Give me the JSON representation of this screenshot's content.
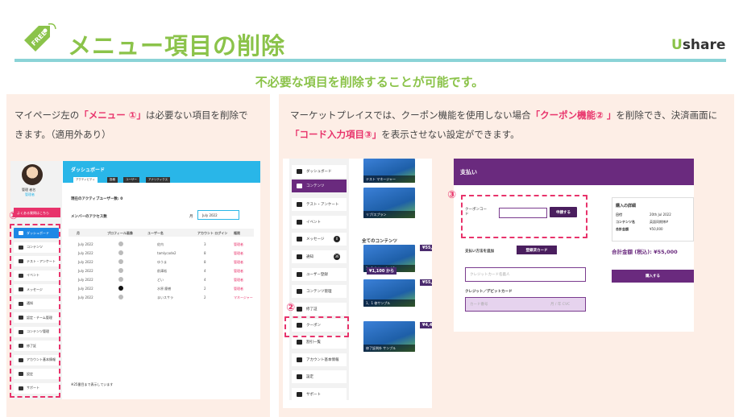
{
  "header": {
    "badge": "FREE",
    "title": "メニュー項目の削除",
    "logo_u": "U",
    "logo_rest": "share",
    "subtitle": "不必要な項目を削除することが可能です。"
  },
  "left": {
    "desc_1": "マイページ左の",
    "desc_hl": "「メニュー ①」",
    "desc_2": "は必要ない項目を削除できます。（適用外あり）",
    "callout_num": "①",
    "dashboard_title": "ダッシュボード",
    "tabs": [
      "アクティビティ",
      "投稿",
      "ユーザー",
      "アナリティクス"
    ],
    "active_users": "現在のアクティブユーザー数: 0",
    "access_title": "メンバーのアクセス数",
    "month_label": "月",
    "month_value": "July 2022",
    "columns": [
      "月",
      "プロフィール画像",
      "ユーザー名",
      "アカウント ログイン",
      "権限"
    ],
    "rows": [
      [
        "July 2022",
        "佐内",
        "3",
        "管理者"
      ],
      [
        "July 2022",
        "tamlycode2",
        "8",
        "管理者"
      ],
      [
        "July 2022",
        "ゆうま",
        "8",
        "管理者"
      ],
      [
        "July 2022",
        "前澤裕",
        "4",
        "管理者"
      ],
      [
        "July 2022",
        "どい",
        "4",
        "管理者"
      ],
      [
        "July 2022",
        "水原 慶樹",
        "2",
        "管理者"
      ],
      [
        "July 2022",
        "まいスサラ",
        "2",
        "マネージャー"
      ]
    ],
    "footnote": "※25番目まで表示しています",
    "user_name": "管理 者名",
    "user_role": "管理者",
    "red_badge": "よくある質問はこちら",
    "menu": [
      "ダッシュボード",
      "コンテンツ",
      "テスト・アンケート",
      "イベント",
      "メッセージ",
      "通知",
      "認定・チーム管理",
      "コンテンツ管理",
      "修了証",
      "アカウント基本情報",
      "設定",
      "サポート"
    ]
  },
  "right": {
    "desc_1": "マーケットプレイスでは、クーポン機能を使用しない場合",
    "desc_hl1": "「クーポン機能② 」",
    "desc_2": "を削除でき、決済画面に",
    "desc_hl2": "「コード入力項目③」",
    "desc_3": "を表示させない設定ができます。",
    "callout_2": "②",
    "callout_3": "③",
    "menu": [
      "ダッシュボード",
      "コンテンツ",
      "テスト・アンケート",
      "イベント",
      "メッセージ",
      "通知",
      "ユーザー登録",
      "コンテンツ管理",
      "修了証",
      "クーポン",
      "割引一覧",
      "アカウント基本情報",
      "設定",
      "サポート"
    ],
    "badges": {
      "message": "0",
      "notice": "36"
    },
    "thumb_labels": [
      "テスト マネージャー",
      "リブ/スプラン",
      "1、1 修サンプル#1",
      "1、1 修サンプル",
      "修了証例外 サンプル"
    ],
    "prices": [
      "¥55,",
      "¥1,100 から",
      "¥55,",
      "¥4,4"
    ],
    "all_contents": "全てのコンテンツ",
    "pay_title": "支払い",
    "coupon_label": "クーポンコード",
    "apply_button": "申請する",
    "detail_title": "購入の詳細",
    "detail_rows": [
      [
        "日付",
        "20th Jul 2022"
      ],
      [
        "コンテンツ名",
        "英語同期博#"
      ],
      [
        "合計金額",
        "¥50,000"
      ]
    ],
    "card_tab1": "支払い方法を追加",
    "card_tab2": "登録済カード",
    "card_name_ph": "クレジットカード名義人",
    "card_label": "クレジット／デビットカード",
    "card_num_ph": "カード番号",
    "card_exp_ph": "月 / 年 CVC",
    "total": "合計金額 (税込): ¥55,000",
    "buy_button": "購入する"
  },
  "colors": {
    "green": "#8bc34a",
    "pink": "#e8336b",
    "teal": "#8bd3d7",
    "purple": "#6a2a7e",
    "blue": "#29b6e8"
  }
}
